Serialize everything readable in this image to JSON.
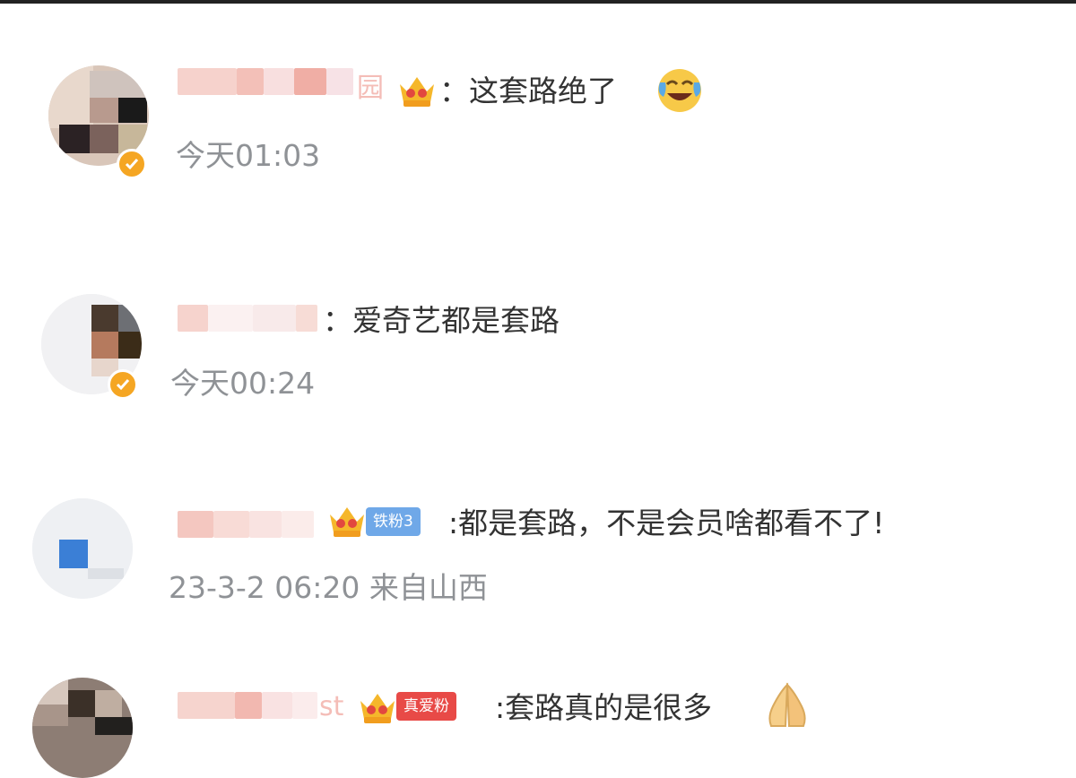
{
  "comments": [
    {
      "name_suffix": "园",
      "text": "：这套路绝了",
      "time": "今天01:03"
    },
    {
      "name_suffix": "",
      "text": "：爱奇艺都是套路",
      "time": "今天00:24"
    },
    {
      "name_suffix": "",
      "badge": "铁粉3",
      "text": ":都是套路，不是会员啥都看不了!",
      "time": "23-3-2 06:20 来自山西"
    },
    {
      "name_suffix": "st",
      "badge": "真爱粉",
      "text": ":套路真的是很多"
    }
  ],
  "colors": {
    "badge_fan": "#6fa8e8",
    "badge_love": "#e84a47",
    "verified": "#f5a623",
    "meta_text": "#8f9296"
  }
}
